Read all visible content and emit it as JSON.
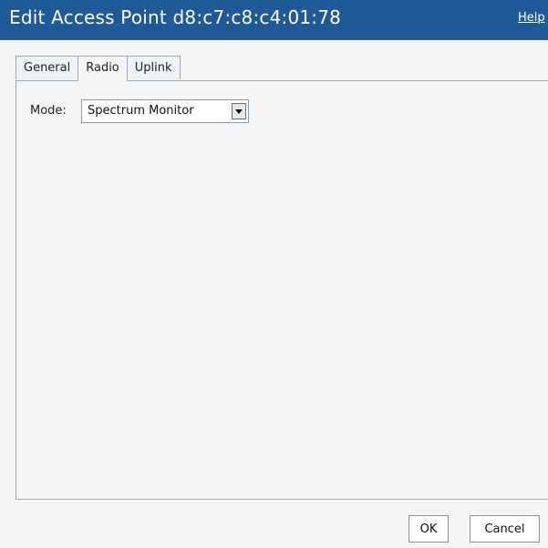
{
  "window": {
    "title": "Edit Access Point d8:c7:c8:c4:01:78",
    "help_label": "Help"
  },
  "tabs": [
    {
      "label": "General",
      "active": false
    },
    {
      "label": "Radio",
      "active": true
    },
    {
      "label": "Uplink",
      "active": false
    }
  ],
  "radio": {
    "mode_label": "Mode:",
    "mode_value": "Spectrum Monitor"
  },
  "actions": {
    "ok_label": "OK",
    "cancel_label": "Cancel"
  },
  "colors": {
    "titlebar": "#1f5a97",
    "panel_bg": "#f5f5f5",
    "border": "#9aa8b8"
  }
}
